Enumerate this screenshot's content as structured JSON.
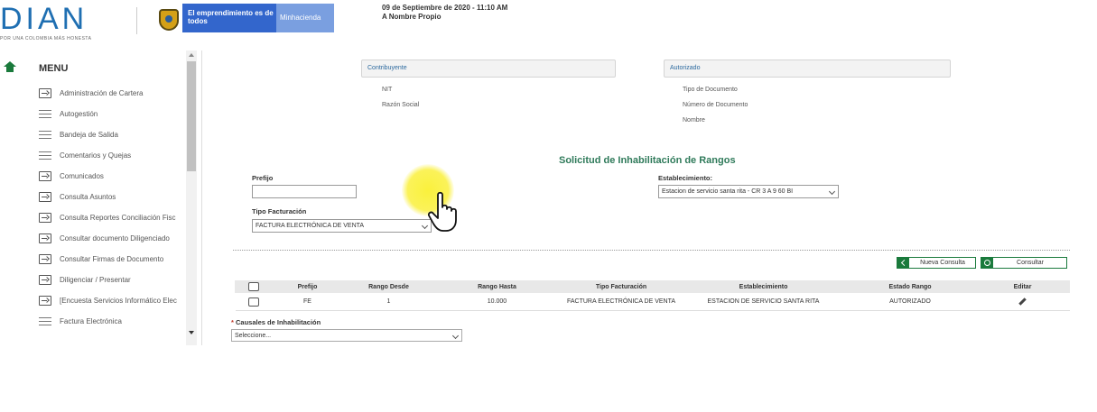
{
  "header": {
    "logo_text": "DIAN",
    "logo_tagline": "POR UNA COLOMBIA MÁS HONESTA",
    "banner_text": "El emprendimiento es de todos",
    "banner_ministry": "Minhacienda",
    "date_text": "09 de Septiembre de 2020 - 11:10 AM",
    "subtitle": "A Nombre Propio"
  },
  "menu": {
    "title": "MENU",
    "items": [
      {
        "label": "Administración de Cartera",
        "icon": "arrow-box-icon"
      },
      {
        "label": "Autogestión",
        "icon": "list-lines-icon"
      },
      {
        "label": "Bandeja de Salida",
        "icon": "list-lines-icon"
      },
      {
        "label": "Comentarios y Quejas",
        "icon": "list-lines-icon"
      },
      {
        "label": "Comunicados",
        "icon": "arrow-box-icon"
      },
      {
        "label": "Consulta Asuntos",
        "icon": "arrow-box-icon"
      },
      {
        "label": "Consulta Reportes Conciliación Fisc",
        "icon": "arrow-box-icon"
      },
      {
        "label": "Consultar documento Diligenciado",
        "icon": "arrow-box-icon"
      },
      {
        "label": "Consultar Firmas de Documento",
        "icon": "arrow-box-icon"
      },
      {
        "label": "Diligenciar / Presentar",
        "icon": "arrow-box-icon"
      },
      {
        "label": "[Encuesta Servicios Informático Elec",
        "icon": "arrow-box-icon"
      },
      {
        "label": "Factura Electrónica",
        "icon": "list-lines-icon"
      }
    ]
  },
  "contribuyente": {
    "heading": "Contribuyente",
    "nit_label": "NIT",
    "razon_label": "Razón Social"
  },
  "autorizado": {
    "heading": "Autorizado",
    "tipo_doc_label": "Tipo de Documento",
    "numero_doc_label": "Número de Documento",
    "nombre_label": "Nombre"
  },
  "form": {
    "title": "Solicitud de Inhabilitación de Rangos",
    "prefijo_label": "Prefijo",
    "prefijo_value": "",
    "establecimiento_label": "Establecimiento:",
    "establecimiento_value": "Estacion de servicio santa rita - CR 3 A 9 60 BI",
    "tipo_facturacion_label": "Tipo Facturación",
    "tipo_facturacion_value": "FACTURA ELECTRÓNICA DE VENTA"
  },
  "buttons": {
    "nueva_consulta": "Nueva Consulta",
    "consultar": "Consultar"
  },
  "table": {
    "headers": [
      "",
      "Prefijo",
      "Rango Desde",
      "Rango Hasta",
      "Tipo Facturación",
      "Establecimiento",
      "Estado Rango",
      "Editar"
    ],
    "rows": [
      {
        "prefijo": "FE",
        "desde": "1",
        "hasta": "10.000",
        "tipo": "FACTURA ELECTRÓNICA DE VENTA",
        "establecimiento": "ESTACION DE SERVICIO SANTA RITA",
        "estado": "AUTORIZADO"
      }
    ]
  },
  "causales": {
    "label": "Causales de Inhabilitación",
    "required_mark": "*",
    "value": "Seleccione..."
  },
  "colors": {
    "brand_blue": "#1f6fb2",
    "accent_green": "#1a7a3c",
    "title_green": "#2f7a5a",
    "gov_blue": "#3366cc",
    "cursor_highlight": "#faf032"
  }
}
